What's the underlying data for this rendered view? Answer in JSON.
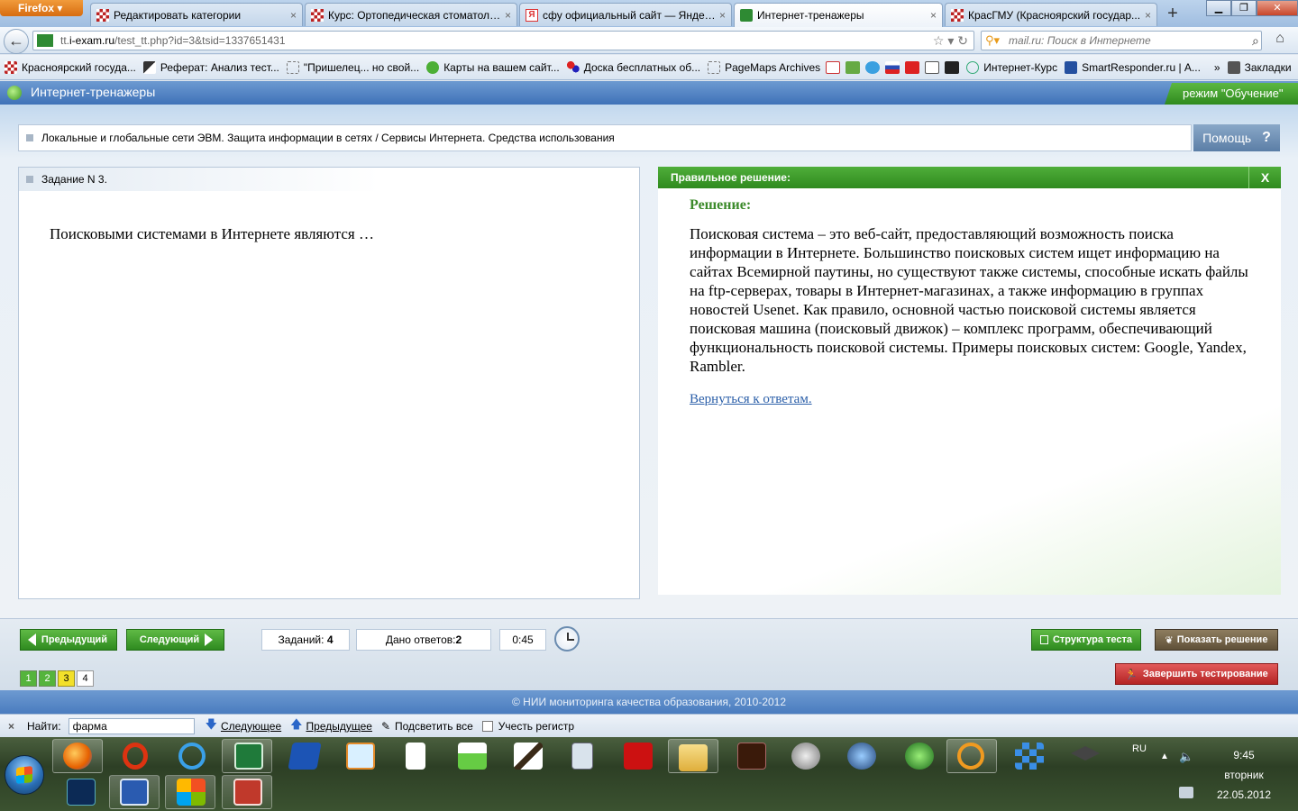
{
  "browser": {
    "menu_label": "Firefox",
    "tabs": [
      {
        "label": "Редактировать категории",
        "icon": "checkered-icon"
      },
      {
        "label": "Курс: Ортопедическая стоматоло...",
        "icon": "checkered-icon"
      },
      {
        "label": "сфу официальный сайт — Яндек...",
        "icon": "yandex-icon"
      },
      {
        "label": "Интернет-тренажеры",
        "icon": "exam-icon"
      },
      {
        "label": "КрасГМУ (Красноярский государ...",
        "icon": "checkered-icon"
      }
    ],
    "close_glyph": "×",
    "newtab_glyph": "+",
    "url_prefix": "tt.",
    "url_host": "i-exam.ru",
    "url_path": "/test_tt.php?id=3&tsid=1337651431",
    "search_placeholder": "mail.ru: Поиск в Интернете",
    "bookmarks": [
      "Красноярский госуда...",
      "Реферат: Анализ тест...",
      "\"Пришелец... но свой...",
      "Карты на вашем сайт...",
      "Доска бесплатных об...",
      "PageMaps Archives"
    ],
    "bookmarks_tail": [
      "Интернет-Курс",
      "SmartResponder.ru | А..."
    ],
    "bookmarks_more": "»",
    "bookmarks_folder": "Закладки"
  },
  "app": {
    "title": "Интернет-тренажеры",
    "mode": "режим \"Обучение\"",
    "topic": "Локальные и глобальные сети ЭВМ. Защита информации в сетях / Сервисы Интернета. Средства использования",
    "help_label": "Помощь",
    "help_glyph": "?",
    "task_label": "Задание N 3.",
    "question": "Поисковыми системами в Интернете являются …",
    "solution": {
      "header": "Правильное решение:",
      "close_glyph": "X",
      "title": "Решение:",
      "text": "Поисковая система – это веб-сайт, предоставляющий возможность поиска информации в Интернете. Большинство поисковых систем ищет информацию на сайтах Всемирной паутины, но существуют также системы, способные искать файлы на ftp-серверах, товары в Интернет-магазинах, а также информацию в группах новостей Usenet. Как правило, основной частью поисковой системы является поисковая машина (поисковый движок) – комплекс программ, обеспечивающий функциональность поисковой системы. Примеры поисковых систем: Google, Yandex, Rambler.",
      "back_link": "Вернуться к ответам."
    },
    "controls": {
      "prev_label": "Предыдущий",
      "next_label": "Следующий",
      "tasks_label": "Заданий:",
      "tasks_value": "4",
      "answers_label": "Дано ответов:",
      "answers_value": "2",
      "timer": "0:45",
      "structure_label": "Структура теста",
      "show_solution_label": "Показать решение",
      "finish_label": "Завершить тестирование",
      "pages": [
        {
          "n": "1",
          "state": "done"
        },
        {
          "n": "2",
          "state": "done"
        },
        {
          "n": "3",
          "state": "current"
        },
        {
          "n": "4",
          "state": "todo"
        }
      ]
    },
    "footer": "© НИИ мониторинга качества образования, 2010-2012"
  },
  "findbar": {
    "close_glyph": "×",
    "label": "Найти:",
    "value": "фарма",
    "next_label": "Следующее",
    "prev_label": "Предыдущее",
    "highlight_label": "Подсветить все",
    "case_label": "Учесть регистр"
  },
  "taskbar": {
    "lang": "RU",
    "time": "9:45",
    "day": "вторник",
    "date": "22.05.2012",
    "colors": {
      "accent_green": "#2f8a1e",
      "app_blue": "#4a7cbf"
    }
  }
}
